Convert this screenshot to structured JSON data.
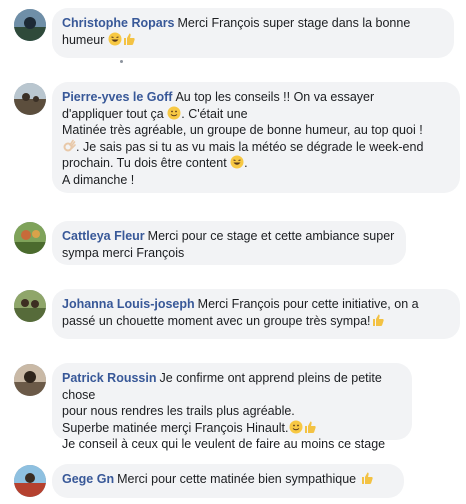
{
  "comments": [
    {
      "author": "Christophe Ropars",
      "lines": [
        "Merci François super stage dans la bonne",
        "humeur "
      ]
    },
    {
      "author": "Pierre-yves le Goff",
      "lines": [
        "Au top les conseils !! On va essayer",
        "d'appliquer tout ça ",
        ". C'était une",
        "Matinée très agréable, un groupe de bonne humeur, au top quoi !",
        ". Je sais pas si tu as vu mais la météo se dégrade le week-end",
        "prochain. Tu dois être content ",
        ".",
        "A dimanche !"
      ]
    },
    {
      "author": "Cattleya Fleur",
      "lines": [
        "Merci pour ce stage et cette ambiance super",
        "sympa merci François"
      ]
    },
    {
      "author": "Johanna Louis-joseph",
      "lines": [
        "Merci François pour cette initiative, on a",
        "passé un chouette moment avec un groupe très sympa!"
      ]
    },
    {
      "author": "Patrick Roussin",
      "lines": [
        "Je confirme ont apprend pleins de petite chose",
        "pour nous rendres les trails plus agréable.",
        "Superbe matinée merçi François Hinault.",
        "Je conseil à ceux qui le veulent de faire au moins ce stage"
      ]
    },
    {
      "author": "Gege Gn",
      "lines": [
        "Merci pour cette matinée bien sympathique "
      ]
    }
  ]
}
